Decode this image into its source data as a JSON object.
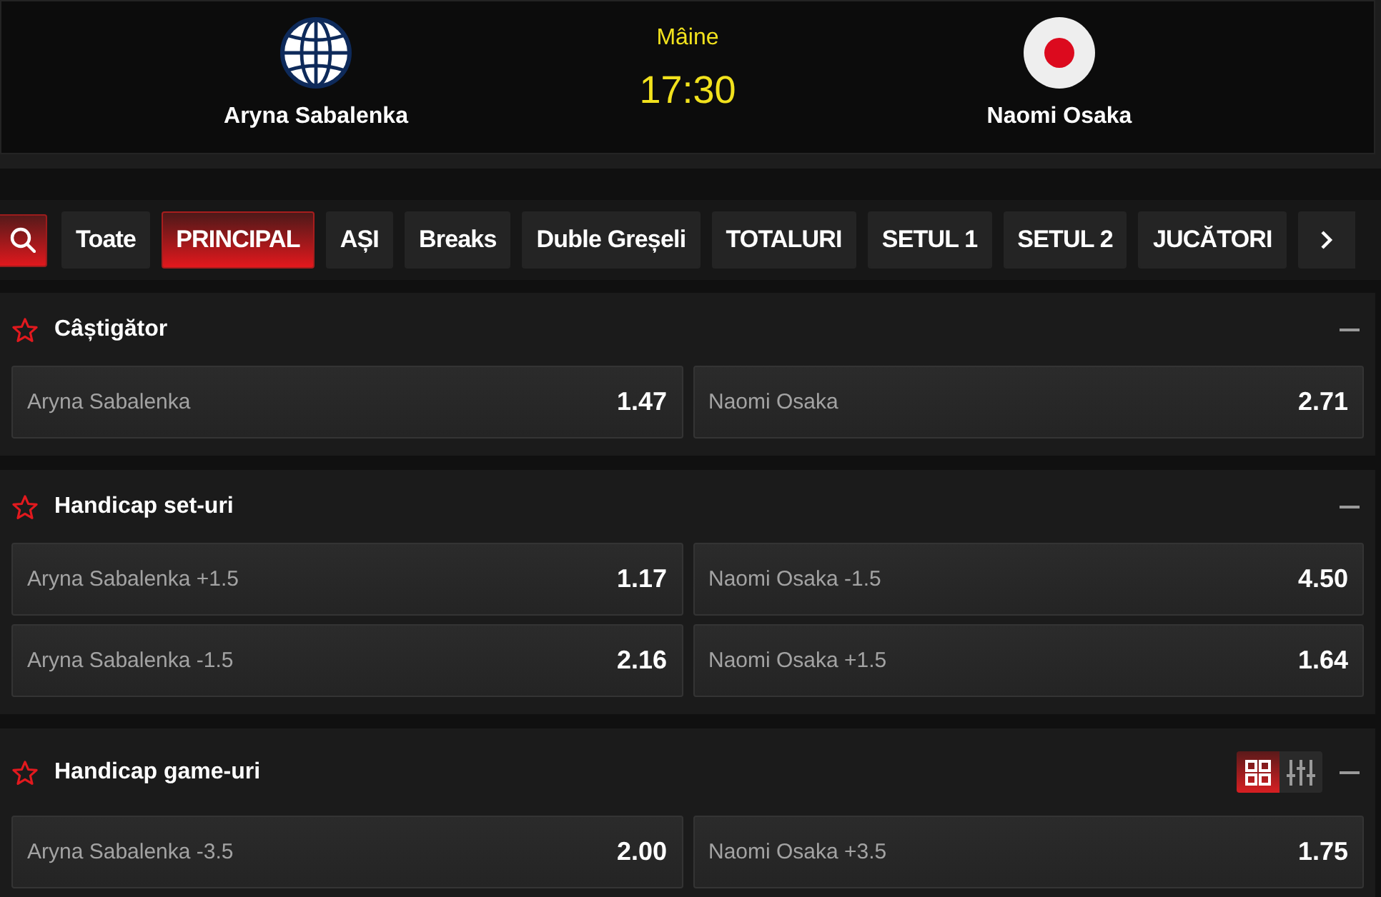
{
  "match": {
    "players": [
      {
        "name": "Aryna Sabalenka",
        "kind": "globe"
      },
      {
        "name": "Naomi Osaka",
        "kind": "japan"
      }
    ],
    "day": "Mâine",
    "time": "17:30"
  },
  "tabs": [
    {
      "label": "Toate",
      "selected": false
    },
    {
      "label": "PRINCIPAL",
      "selected": true
    },
    {
      "label": "AȘI",
      "selected": false
    },
    {
      "label": "Breaks",
      "selected": false
    },
    {
      "label": "Duble Greșeli",
      "selected": false
    },
    {
      "label": "TOTALURI",
      "selected": false
    },
    {
      "label": "SETUL 1",
      "selected": false
    },
    {
      "label": "SETUL 2",
      "selected": false
    },
    {
      "label": "JUCĂTORI",
      "selected": false
    }
  ],
  "markets": [
    {
      "title": "Câștigător",
      "rows": [
        [
          {
            "label": "Aryna Sabalenka",
            "odds": "1.47"
          },
          {
            "label": "Naomi Osaka",
            "odds": "2.71"
          }
        ]
      ]
    },
    {
      "title": "Handicap set-uri",
      "rows": [
        [
          {
            "label": "Aryna Sabalenka +1.5",
            "odds": "1.17"
          },
          {
            "label": "Naomi Osaka -1.5",
            "odds": "4.50"
          }
        ],
        [
          {
            "label": "Aryna Sabalenka -1.5",
            "odds": "2.16"
          },
          {
            "label": "Naomi Osaka +1.5",
            "odds": "1.64"
          }
        ]
      ]
    },
    {
      "title": "Handicap game-uri",
      "view_options": [
        {
          "kind": "grid",
          "selected": true
        },
        {
          "kind": "sliders",
          "selected": false
        }
      ],
      "rows": [
        [
          {
            "label": "Aryna Sabalenka -3.5",
            "odds": "2.00"
          },
          {
            "label": "Naomi Osaka +3.5",
            "odds": "1.75"
          }
        ]
      ]
    }
  ]
}
